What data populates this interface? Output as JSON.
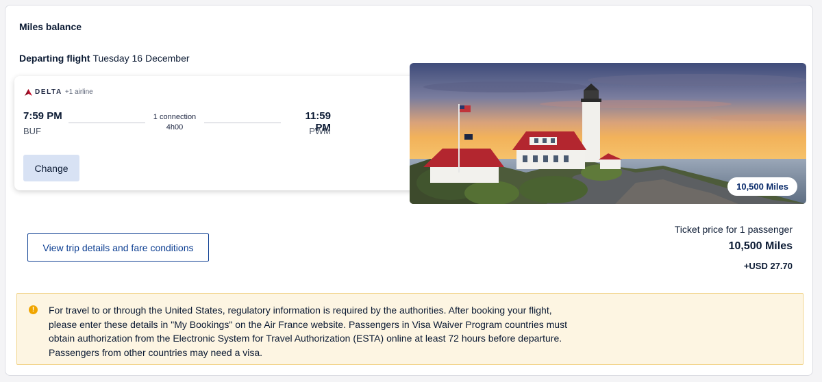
{
  "section": {
    "title": "Miles balance"
  },
  "departing": {
    "label": "Departing flight",
    "date": "Tuesday 16 December"
  },
  "flight": {
    "airline_name": "DELTA",
    "extra_airlines": "+1 airline",
    "departure_time": "7:59 PM",
    "departure_airport": "BUF",
    "arrival_time": "11:59 PM",
    "arrival_airport": "PWM",
    "connections": "1 connection",
    "duration": "4h00",
    "change_label": "Change"
  },
  "destination_image": {
    "miles_badge": "10,500 Miles"
  },
  "trip_details_label": "View trip details and fare conditions",
  "price": {
    "label": "Ticket price for 1 passenger",
    "miles": "10,500 Miles",
    "usd": "+USD 27.70"
  },
  "notice": {
    "icon": "exclamation-icon",
    "text": "For travel to or through the United States, regulatory information is required by the authorities. After booking your flight, please enter these details in \"My Bookings\" on the Air France website. Passengers in Visa Waiver Program countries must obtain authorization from the Electronic System for Travel Authorization (ESTA) online at least 72 hours before departure. Passengers from other countries may need a visa."
  },
  "colors": {
    "primary_blue": "#0b3d91",
    "delta_red": "#c8102e",
    "notice_bg": "#fdf5e2",
    "notice_border": "#f2d48a",
    "warning_icon": "#f0a500",
    "change_button_bg": "#d8e2f4"
  }
}
